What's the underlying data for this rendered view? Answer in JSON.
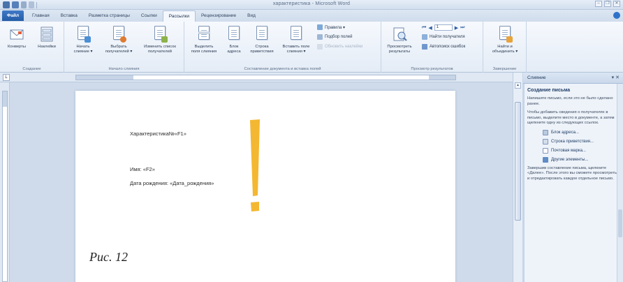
{
  "window": {
    "title": "характеристика - Microsoft Word",
    "controls": [
      "–",
      "❐",
      "✕"
    ]
  },
  "tabs": {
    "file": "Файл",
    "items": [
      "Главная",
      "Вставка",
      "Разметка страницы",
      "Ссылки",
      "Рассылки",
      "Рецензирование",
      "Вид"
    ],
    "active": "Рассылки"
  },
  "ribbon": {
    "groups": {
      "create": {
        "label": "Создание",
        "envelopes": "Конверты",
        "labels": "Наклейки"
      },
      "start_merge": {
        "label": "Начало слияния",
        "start_line1": "Начать",
        "start_line2": "слияние ▾",
        "select_line1": "Выбрать",
        "select_line2": "получателей ▾",
        "edit_line1": "Изменить список",
        "edit_line2": "получателей"
      },
      "write_insert": {
        "label": "Составление документа и вставка полей",
        "highlight_line1": "Выделить",
        "highlight_line2": "поля слияния",
        "address_line1": "Блок",
        "address_line2": "адреса",
        "greeting_line1": "Строка",
        "greeting_line2": "приветствия",
        "insert_line1": "Вставить поле",
        "insert_line2": "слияния ▾",
        "rules": "Правила ▾",
        "match": "Подбор полей",
        "update": "Обновить наклейки"
      },
      "preview": {
        "label": "Просмотр результатов",
        "preview_line1": "Просмотреть",
        "preview_line2": "результаты",
        "record": "1",
        "find": "Найти получателя",
        "auto_check": "Автопоиск ошибок"
      },
      "finish": {
        "label": "Завершение",
        "finish_line1": "Найти и",
        "finish_line2": "объединить ▾"
      }
    }
  },
  "document": {
    "line1": "Характеристика№«F1»",
    "line2": "Имя: «F2»",
    "line3": "Дата рождения: «Дата_рождения»",
    "caption": "Рис. 12",
    "exclaim_color": "#f4b731"
  },
  "taskpane": {
    "title": "Слияние",
    "close": "▾ ✕",
    "heading": "Создание письма",
    "para1": "Напишите письмо, если это не было сделано ранее.",
    "para2": "Чтобы добавить сведения о получателях в письмо, выделите место в документе, а затем щелкните одну из следующих ссылок.",
    "links": [
      "Блок адреса...",
      "Строка приветствия...",
      "Почтовая марка...",
      "Другие элементы..."
    ],
    "para3": "Завершив составление письма, щелкните «Далее». После этого вы сможете просмотреть и отредактировать каждое отдельное письмо."
  }
}
